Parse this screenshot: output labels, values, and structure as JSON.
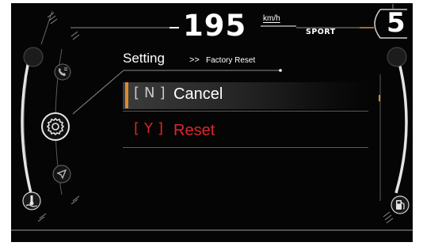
{
  "header": {
    "speed": "195",
    "speed_unit": "km/h",
    "ride_mode": "SPORT",
    "gear": "5"
  },
  "menu": {
    "title": "Setting",
    "breadcrumb_separator": ">>",
    "breadcrumb": "Factory Reset",
    "options": [
      {
        "key": "N",
        "label": "Cancel",
        "selected": true
      },
      {
        "key": "Y",
        "label": "Reset",
        "selected": false
      }
    ]
  },
  "icons": {
    "left_rail": [
      "phone-icon",
      "settings-icon",
      "navigation-icon"
    ],
    "left_gauge": "coolant-temperature-icon",
    "right_gauge": "fuel-pump-icon"
  },
  "colors": {
    "selection_accent": "#e08a2e",
    "destructive": "#e0252b",
    "background": "#050505"
  }
}
